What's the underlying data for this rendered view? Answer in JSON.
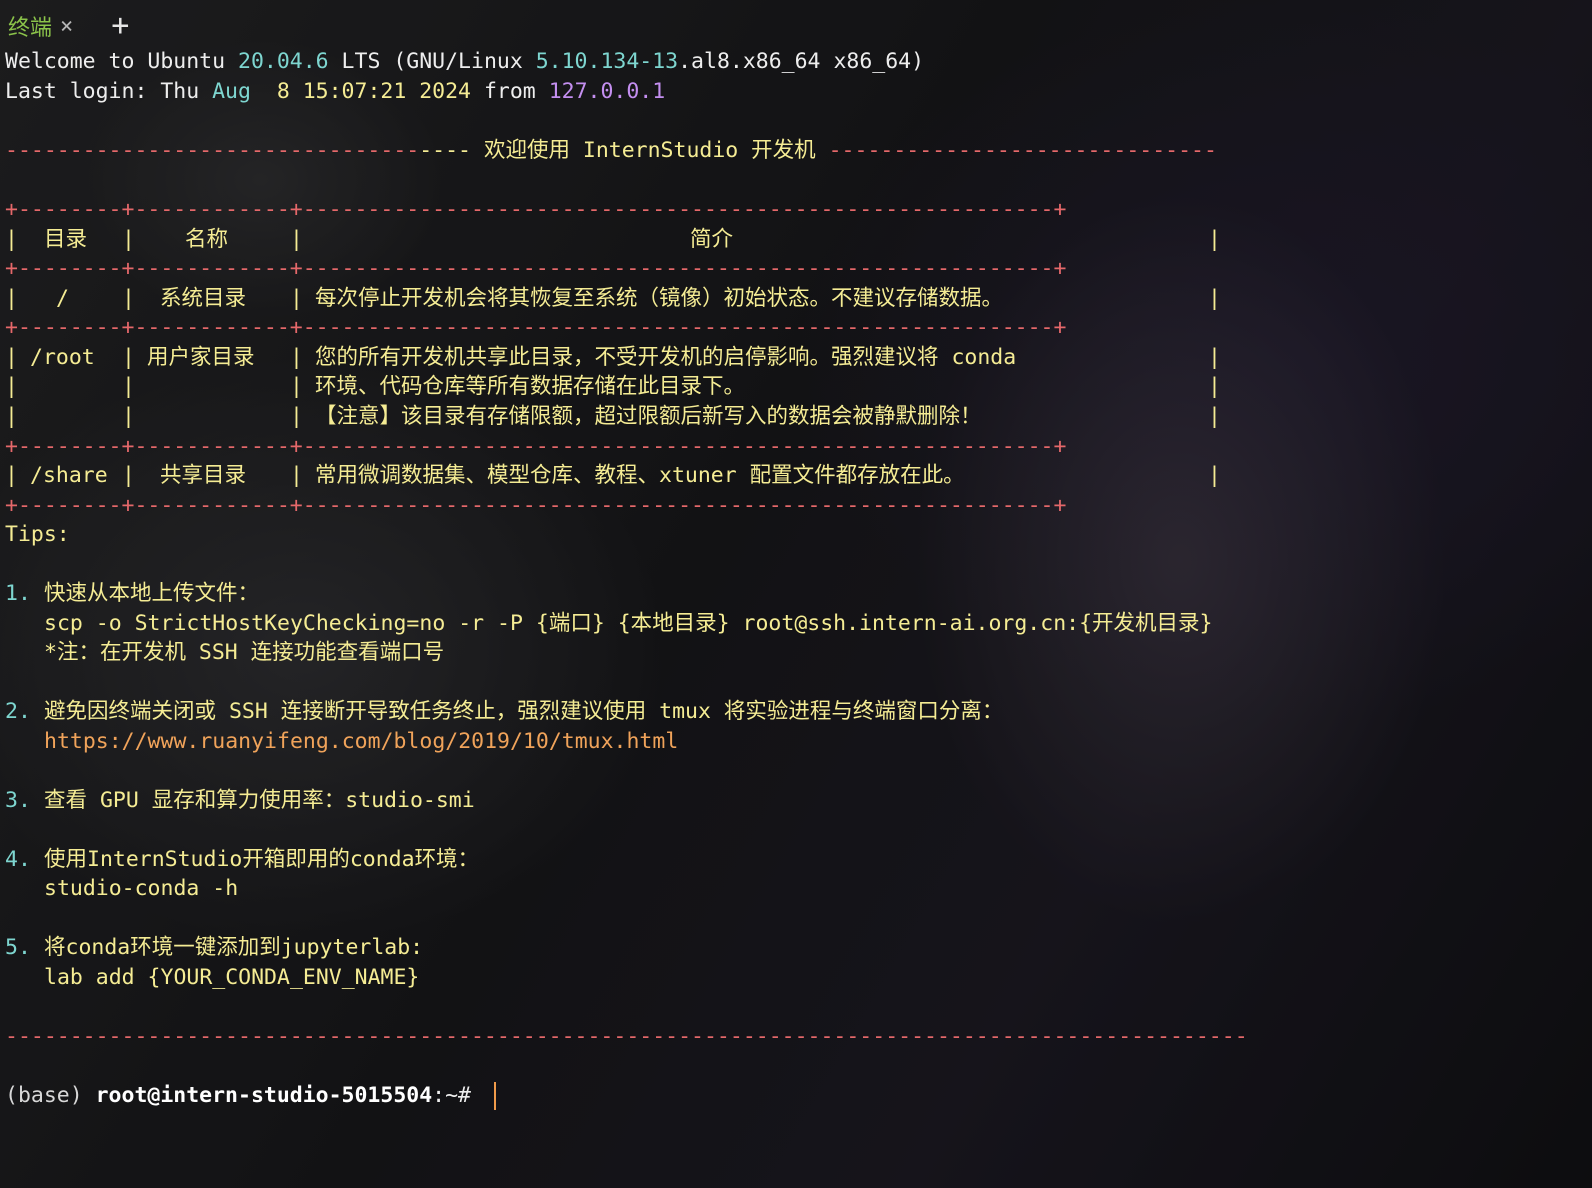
{
  "tab": {
    "title": "终端",
    "close": "×",
    "new": "+"
  },
  "welcome": {
    "prefix": "Welcome to Ubuntu ",
    "version": "20.04.6",
    "lts": " LTS (GNU/Linux ",
    "kernel": "5.10.134-13",
    "arch": ".al8.x86_64 x86_64)"
  },
  "last_login": {
    "prefix": "Last login: Thu ",
    "month": "Aug",
    "time": "  8 15:07:21 2024",
    "from": " from ",
    "ip": "127.0.0.1"
  },
  "banner": {
    "left": "--------------------------------",
    "left_end": "----",
    "title": " 欢迎使用 InternStudio 开发机 ",
    "right": "------------------------------"
  },
  "table": {
    "border": "+--------+------------+----------------------------------------------------------+",
    "header": [
      "目录",
      "名称",
      "简介"
    ],
    "rows": [
      {
        "dir": "/",
        "name": "系统目录",
        "desc": [
          "每次停止开发机会将其恢复至系统（镜像）初始状态。不建议存储数据。"
        ]
      },
      {
        "dir": "/root",
        "name": "用户家目录",
        "desc": [
          "您的所有开发机共享此目录，不受开发机的启停影响。强烈建议将 conda",
          "环境、代码仓库等所有数据存储在此目录下。",
          "【注意】该目录有存储限额，超过限额后新写入的数据会被静默删除！"
        ]
      },
      {
        "dir": "/share",
        "name": "共享目录",
        "desc": [
          "常用微调数据集、模型仓库、教程、xtuner 配置文件都存放在此。"
        ]
      }
    ]
  },
  "tips": {
    "heading": "Tips:",
    "items": [
      {
        "num": "1.",
        "text": "快速从本地上传文件：",
        "sub": [
          "scp -o StrictHostKeyChecking=no -r -P {端口} {本地目录} root@ssh.intern-ai.org.cn:{开发机目录}",
          "*注：在开发机 SSH 连接功能查看端口号"
        ]
      },
      {
        "num": "2.",
        "text": "避免因终端关闭或 SSH 连接断开导致任务终止，强烈建议使用 tmux 将实验进程与终端窗口分离：",
        "sub": [
          "https://www.ruanyifeng.com/blog/2019/10/tmux.html"
        ]
      },
      {
        "num": "3.",
        "text": "查看 GPU 显存和算力使用率：studio-smi",
        "sub": []
      },
      {
        "num": "4.",
        "text": "使用InternStudio开箱即用的conda环境：",
        "sub": [
          "studio-conda -h"
        ]
      },
      {
        "num": "5.",
        "text": "将conda环境一键添加到jupyterlab:",
        "sub": [
          "lab add {YOUR_CONDA_ENV_NAME}"
        ]
      }
    ]
  },
  "footer_rule": "------------------------------------------------------------------------------------------------",
  "prompt": {
    "env": "(base) ",
    "user_host": "root@intern-studio-5015504",
    "path": ":~# "
  },
  "colors": {
    "yellow": "#f5ec94",
    "cyan": "#7ed6d0",
    "purple": "#c48ff0",
    "red": "#e5686a",
    "orange": "#f0a35a",
    "green_tab": "#8bc34a"
  }
}
